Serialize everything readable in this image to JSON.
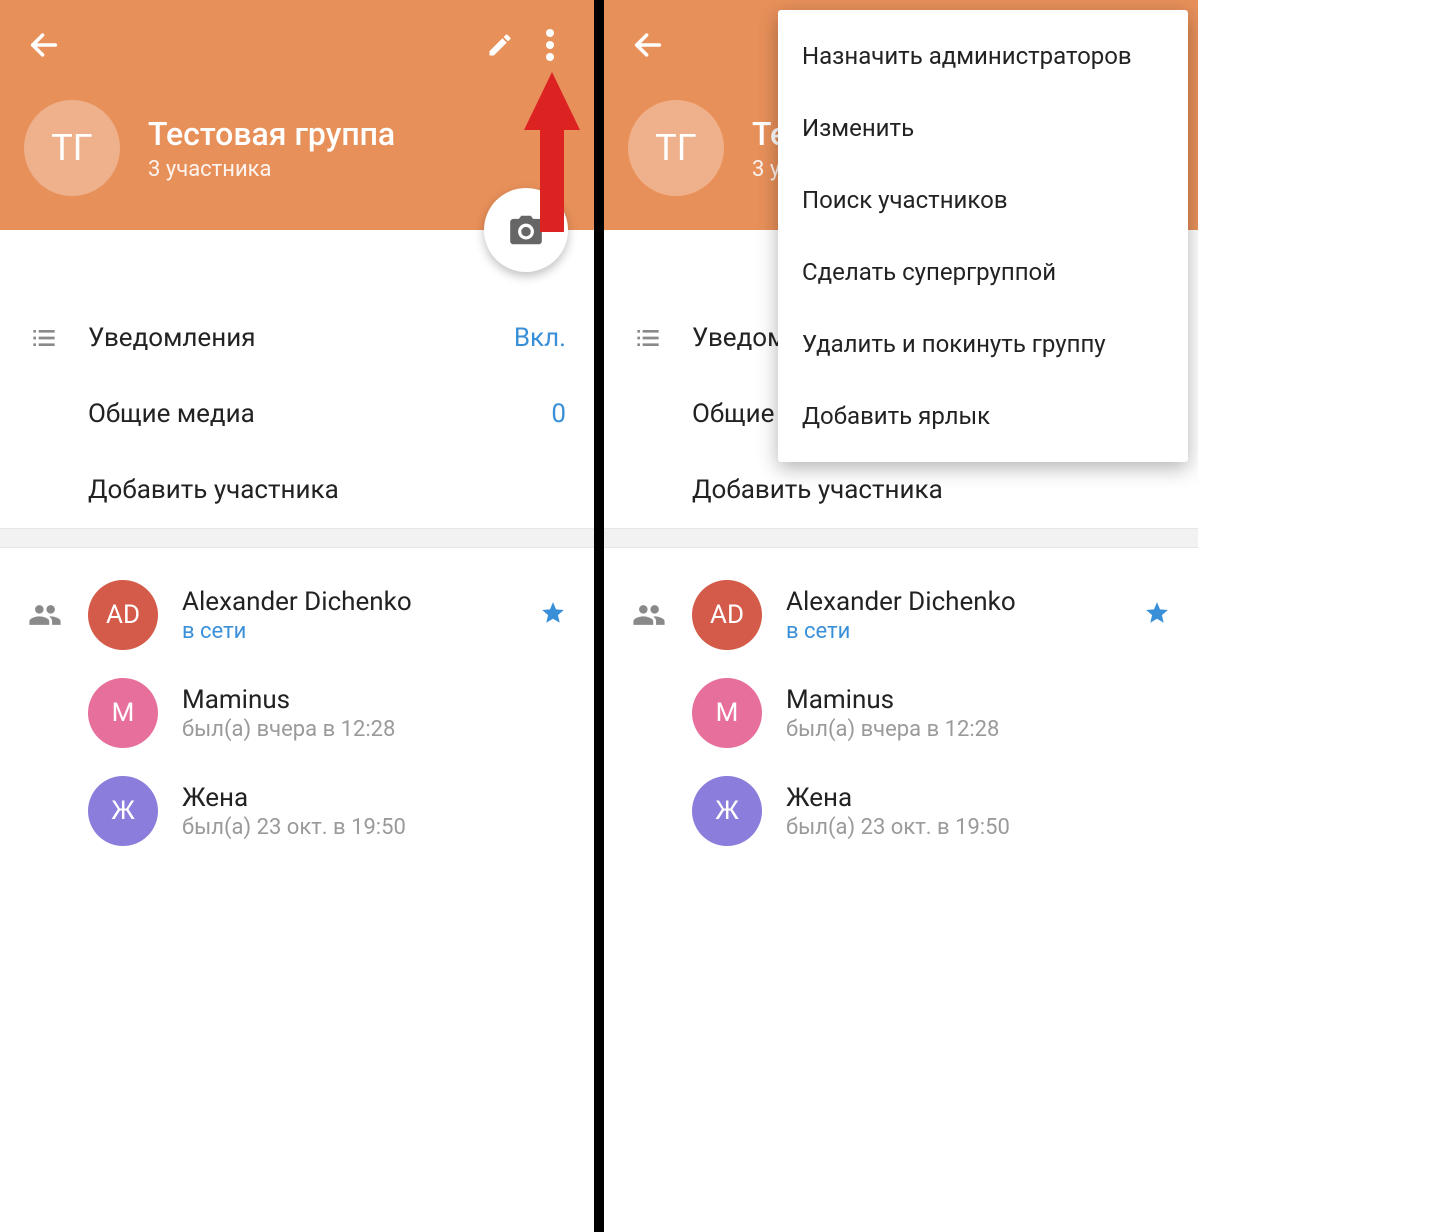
{
  "header": {
    "group_avatar_initials": "ТГ",
    "group_title": "Тестовая группа",
    "group_subtitle": "3 участника"
  },
  "rows": {
    "notifications": {
      "label": "Уведомления",
      "value": "Вкл."
    },
    "shared_media": {
      "label": "Общие медиа",
      "value": "0"
    },
    "add_member": {
      "label": "Добавить участника"
    }
  },
  "members": [
    {
      "initials": "AD",
      "avatar_color": "#d45a49",
      "name": "Alexander Dichenko",
      "status": "в сети",
      "online": true,
      "starred": true
    },
    {
      "initials": "М",
      "avatar_color": "#e76f9c",
      "name": "Maminus",
      "status": "был(а) вчера в 12:28",
      "online": false,
      "starred": false
    },
    {
      "initials": "Ж",
      "avatar_color": "#8a7ddb",
      "name": "Жена",
      "status": "был(а) 23 окт. в 19:50",
      "online": false,
      "starred": false
    }
  ],
  "menu": {
    "items": [
      "Назначить администраторов",
      "Изменить",
      "Поиск участников",
      "Сделать супергруппой",
      "Удалить и покинуть группу",
      "Добавить ярлык"
    ]
  }
}
